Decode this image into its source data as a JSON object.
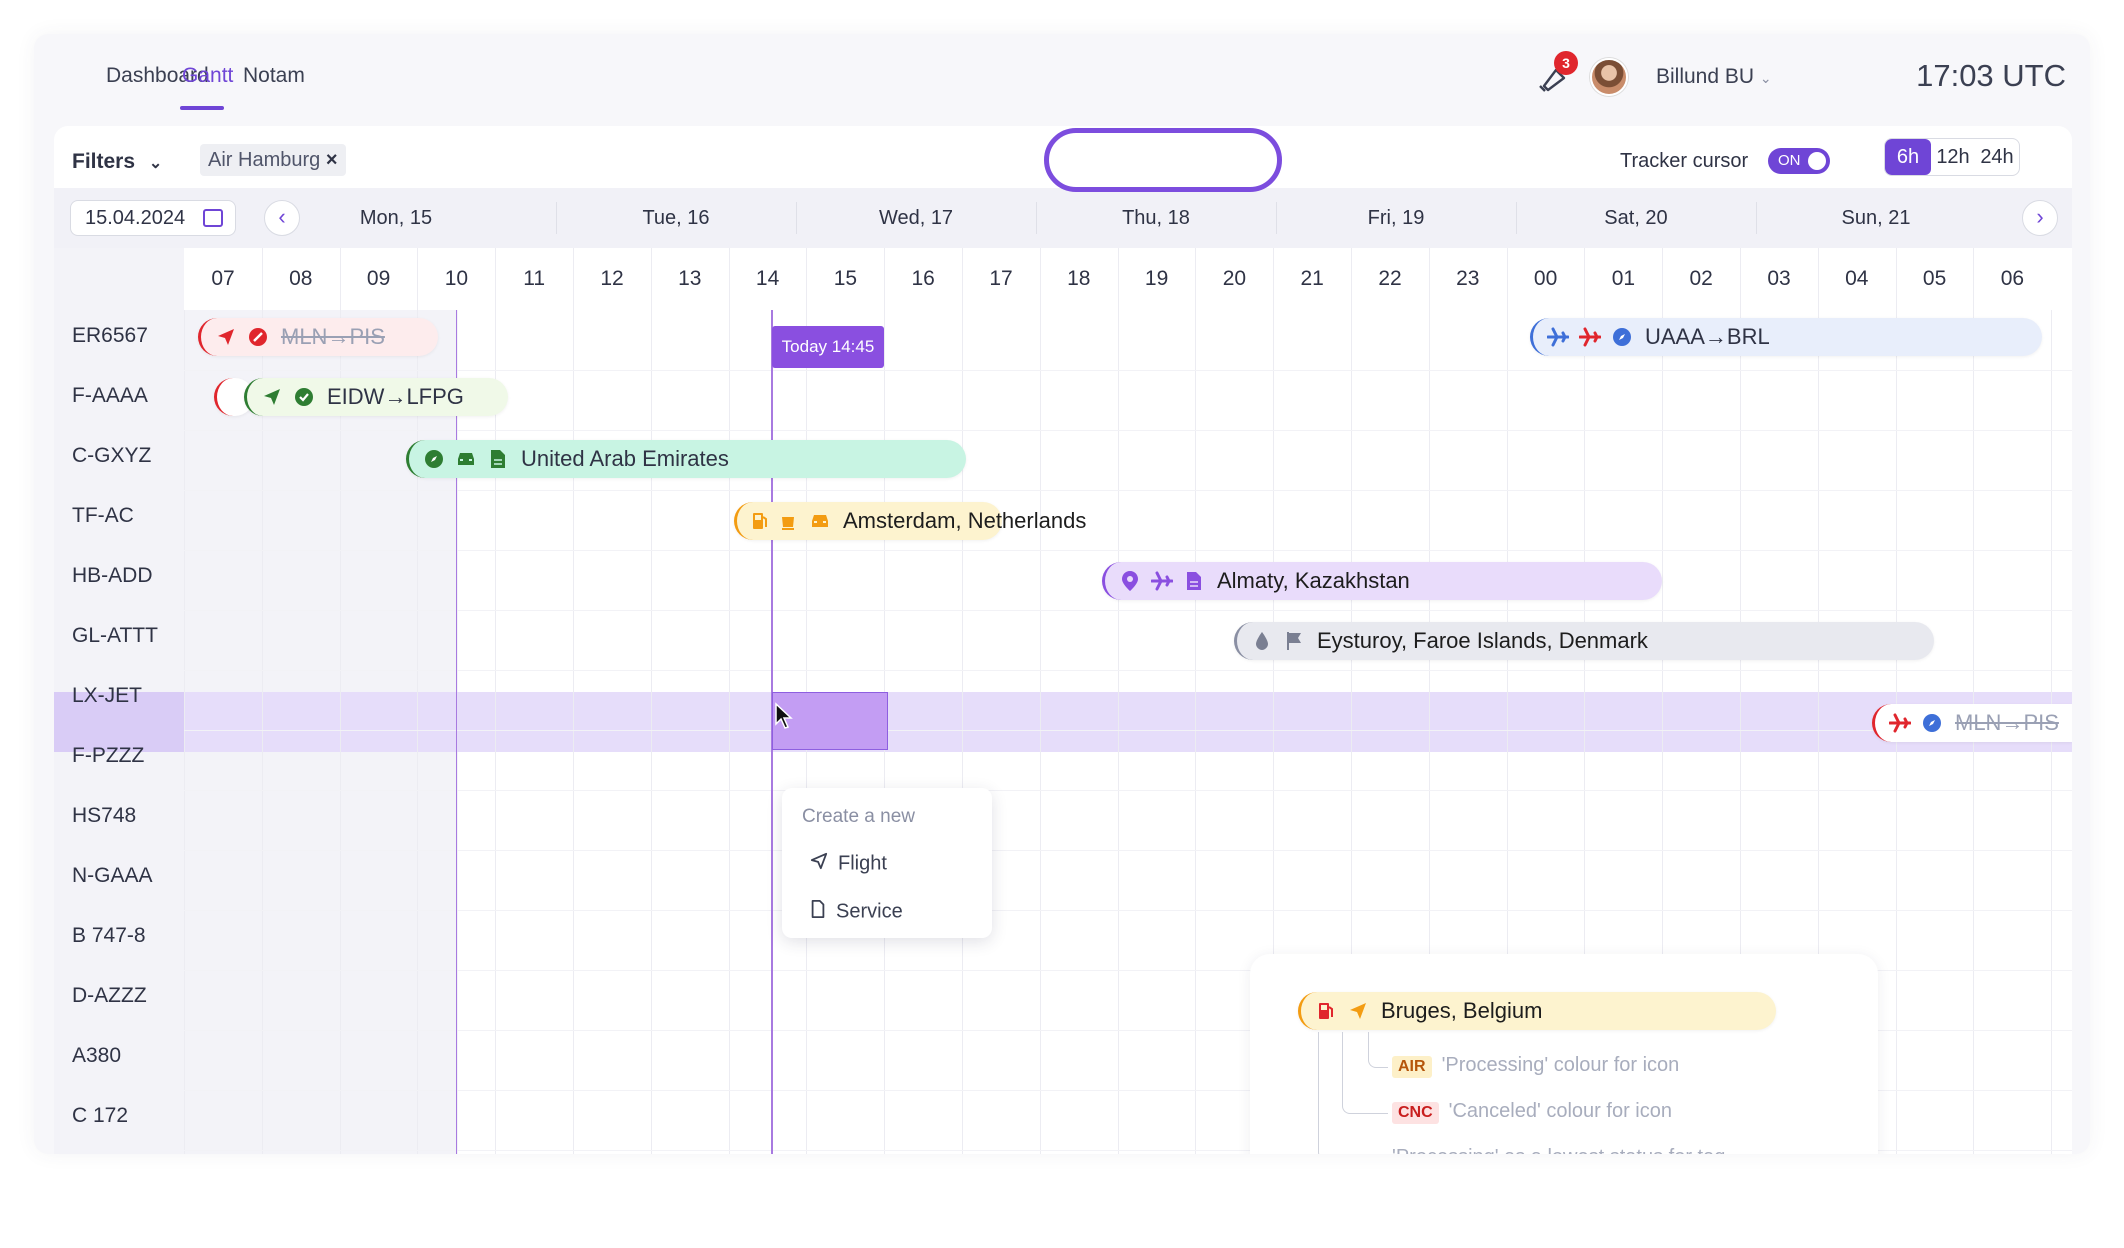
{
  "nav": {
    "tabs": [
      "Dashboard",
      "Gantt",
      "Notam"
    ],
    "active": "Gantt"
  },
  "header": {
    "notifications": "3",
    "business_unit": "Billund BU",
    "clock": "17:03 UTC"
  },
  "filters": {
    "label": "Filters",
    "chip": "Air Hamburg",
    "chip_remove": "×"
  },
  "tracker": {
    "label": "Tracker cursor",
    "toggle": "ON"
  },
  "range": {
    "options": [
      "6h",
      "12h",
      "24h"
    ],
    "selected": "6h"
  },
  "calendar": {
    "date": "15.04.2024",
    "days": [
      "Mon, 15",
      "Tue, 16",
      "Wed, 17",
      "Thu, 18",
      "Fri, 19",
      "Sat, 20",
      "Sun, 21"
    ],
    "hours": [
      "07",
      "08",
      "09",
      "10",
      "11",
      "12",
      "13",
      "14",
      "15",
      "16",
      "17",
      "18",
      "19",
      "20",
      "21",
      "22",
      "23",
      "00",
      "01",
      "02",
      "03",
      "04",
      "05",
      "06"
    ]
  },
  "rows": [
    "ER6567",
    "F-AAAA",
    "C-GXYZ",
    "TF-AC",
    "HB-ADD",
    "GL-ATTT",
    "LX-JET",
    "F-PZZZ",
    "HS748",
    "N-GAAA",
    "B 747-8",
    "D-AZZZ",
    "A380",
    "C 172"
  ],
  "today_label": "Today 14:45",
  "bars": [
    {
      "label": "MLN→PIS",
      "status": "canceled"
    },
    {
      "label": "EIDW→LFPG",
      "status": "active"
    },
    {
      "label": "United Arab Emirates",
      "status": "active"
    },
    {
      "label": "Amsterdam, Netherlands",
      "status": "processing"
    },
    {
      "label": "Almaty, Kazakhstan",
      "status": "planned"
    },
    {
      "label": "Eysturoy, Faroe Islands, Denmark",
      "status": "neutral"
    },
    {
      "label": "UAAA→BRL",
      "status": "scheduled"
    },
    {
      "label": "MLN→PIS",
      "status": "canceled"
    }
  ],
  "popup": {
    "title": "Create a new",
    "items": [
      "Flight",
      "Service"
    ]
  },
  "legend": {
    "bar": "Bruges, Belgium",
    "rows": [
      {
        "tag": "AIR",
        "text": "'Processing' colour for icon"
      },
      {
        "tag": "CNC",
        "text": "'Canceled' colour for icon"
      },
      {
        "tag": "",
        "text": "'Processing' as a lowest status for tag"
      }
    ]
  },
  "colors": {
    "accent": "#6f45d6",
    "canceled": "#e0262d",
    "active": "#2e7d32",
    "processing": "#f39c12",
    "planned": "#8a4fe0",
    "scheduled": "#3e6fd8"
  }
}
